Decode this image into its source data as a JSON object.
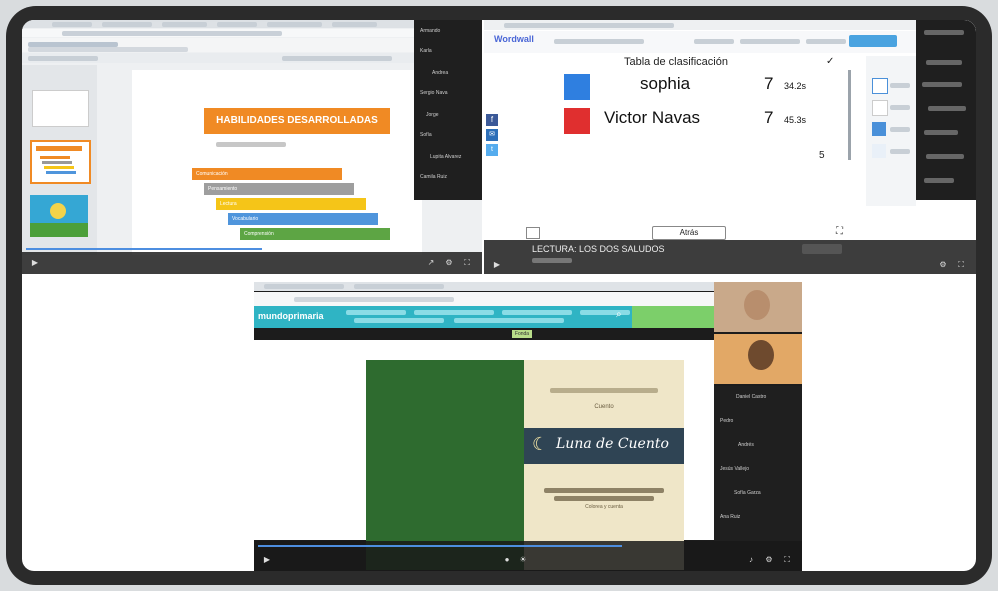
{
  "slides": {
    "title": "HABILIDADES DESARROLLADAS",
    "bars": [
      "Comunicación",
      "Pensamiento",
      "Lectura",
      "Vocabulario",
      "Comprensión"
    ],
    "participants": [
      "Armando",
      "Karla",
      "Andrea",
      "Sergio Nava",
      "Jorge",
      "Sofía",
      "Lupita Alvarez",
      "Camila Ruiz"
    ]
  },
  "wordwall": {
    "brand": "Wordwall",
    "table_title": "Tabla de clasificación",
    "rows": [
      {
        "name": "sophia",
        "score": "7",
        "time": "34.2s",
        "color": "#2f7fe0"
      },
      {
        "name": "Victor Navas",
        "score": "7",
        "time": "45.3s",
        "color": "#e02f2f"
      }
    ],
    "side_number": "5",
    "button_label": "Atrás",
    "activity_title": "LECTURA: LOS DOS SALUDOS"
  },
  "reader": {
    "brand": "mundoprimaria",
    "page_tag": "Fonda",
    "book_subtitle": "Cuento",
    "book_title": "Luna de Cuento",
    "footer_text": "Colorea y cuenta",
    "participants": [
      "Daniel Castro",
      "Pedro",
      "Andrés",
      "Jesús Vallejo",
      "Sofía Garza",
      "Ana Ruiz"
    ]
  }
}
